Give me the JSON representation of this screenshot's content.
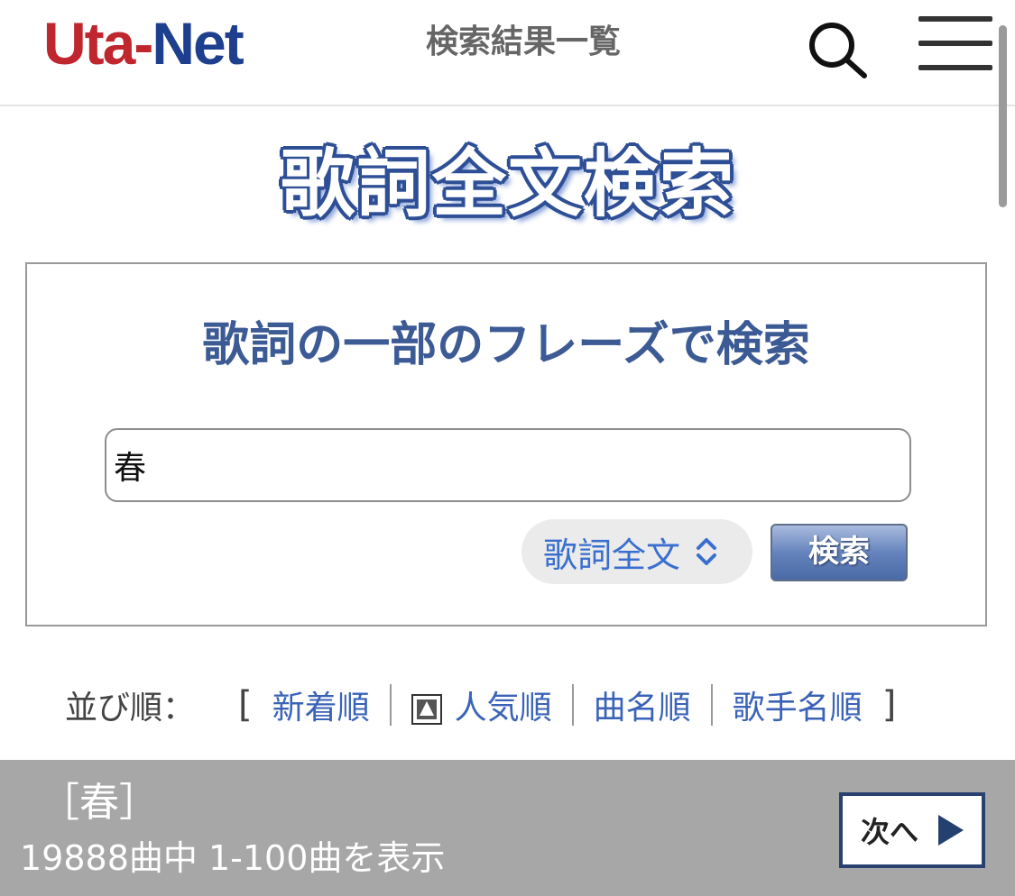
{
  "header": {
    "logo_part1": "Uta-",
    "logo_part2": "Net",
    "page_title": "検索結果一覧"
  },
  "banner": {
    "text": "歌詞全文検索"
  },
  "search": {
    "heading": "歌詞の一部のフレーズで検索",
    "query_value": "春",
    "mode_selected": "歌詞全文",
    "submit_label": "検索"
  },
  "sort": {
    "label": "並び順：",
    "open_bracket": "[",
    "close_bracket": "]",
    "options": [
      {
        "label": "新着順"
      },
      {
        "label": "人気順",
        "active": true
      },
      {
        "label": "曲名順"
      },
      {
        "label": "歌手名順"
      }
    ]
  },
  "results": {
    "query_label": "［春］",
    "count_text": "19888曲中 1-100曲を表示",
    "next_label": "次へ"
  },
  "colors": {
    "logo_red": "#c0262d",
    "logo_blue": "#1d3f8e",
    "link_blue": "#3a63b8",
    "heading_blue": "#3c5a94",
    "results_bar": "#a7a7a7"
  }
}
